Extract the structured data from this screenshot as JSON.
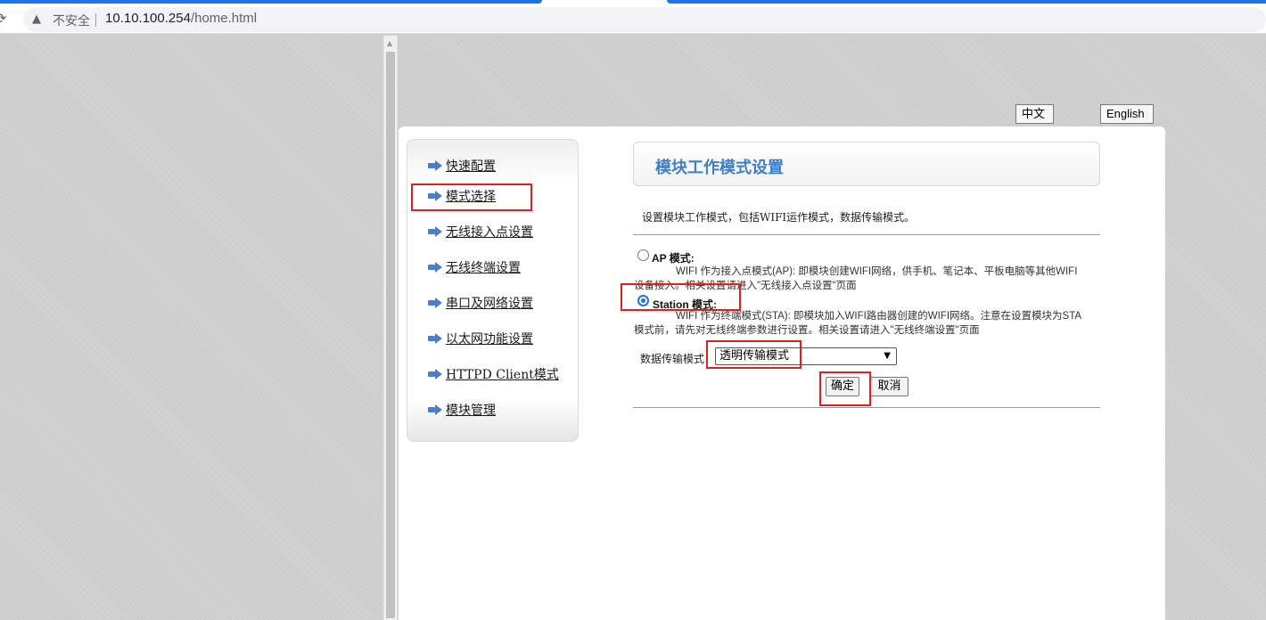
{
  "browser": {
    "security_label": "不安全",
    "url_host": "10.10.100.254",
    "url_path": "/home.html"
  },
  "lang": {
    "zh_label": "中文",
    "en_label": "English"
  },
  "sidebar": {
    "items": [
      {
        "label": "快速配置"
      },
      {
        "label": "模式选择"
      },
      {
        "label": "无线接入点设置"
      },
      {
        "label": "无线终端设置"
      },
      {
        "label": "串口及网络设置"
      },
      {
        "label": "以太网功能设置"
      },
      {
        "label": "HTTPD Client模式"
      },
      {
        "label": "模块管理"
      }
    ]
  },
  "main": {
    "title": "模块工作模式设置",
    "description": "设置模块工作模式，包括WIFI运作模式，数据传输模式。",
    "ap": {
      "label": "AP 模式:",
      "desc_line1": "WIFI 作为接入点模式(AP): 即模块创建WIFI网络，供手机、笔记本、平板电脑等其他WIFI",
      "desc_line2": "设备接入。相关设置请进入\"无线接入点设置\"页面"
    },
    "station": {
      "label": "Station 模式:",
      "desc_line1": "WIFI 作为终端模式(STA): 即模块加入WIFI路由器创建的WIFI网络。注意在设置模块为STA",
      "desc_line2": "模式前，请先对无线终端参数进行设置。相关设置请进入\"无线终端设置\"页面"
    },
    "transfer_label": "数据传输模式",
    "transfer_value": "透明传输模式",
    "ok_label": "确定",
    "cancel_label": "取消"
  },
  "colors": {
    "accent": "#3f7fc6",
    "highlight": "#e02020",
    "arrow": "#4a7fc8"
  }
}
